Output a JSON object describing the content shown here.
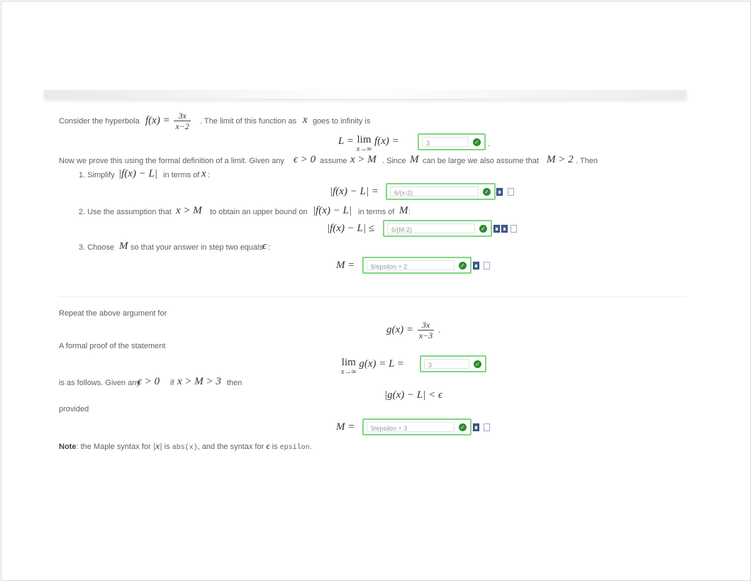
{
  "intro": {
    "consider": "Consider the hyperbola",
    "f_lhs": "f(x) =",
    "f_num": "3x",
    "f_den": "x−2",
    "limit_text": ". The limit of this function as",
    "x": "x",
    "goes_text": "goes to infinity is",
    "L_eq": "L =",
    "lim": "lim",
    "lim_sub": "x→∞",
    "fx_eq": "f(x) =",
    "answer_L": "3"
  },
  "proof_line": {
    "text1": "Now we prove this using the formal definition of a limit. Given any",
    "eps_gt0": "ϵ > 0",
    "assume": "assume",
    "x_gt_M": "x > M",
    "since": ". Since",
    "M": "M",
    "large": "can be large we also assume that",
    "M_gt2": "M > 2",
    "then": ". Then"
  },
  "steps": [
    {
      "label": "1. Simplify",
      "math": "|f(x) − L|",
      "rest": "in terms of",
      "var": "x",
      "tail": ":",
      "lhs": "|f(x) − L| =",
      "answer": "6/(x-2)"
    },
    {
      "label": "2. Use the assumption that",
      "math": "x > M",
      "rest": "to obtain an upper bound on",
      "math2": "|f(x) − L|",
      "rest2": "in terms of",
      "var": "M",
      "tail": ":",
      "lhs": "|f(x) − L| ≤",
      "answer": "6/(M-2)"
    },
    {
      "label": "3. Choose",
      "math": "M",
      "rest": "so that your answer in step two equals",
      "var": "ϵ",
      "tail": ":",
      "lhs": "M =",
      "answer": "6/epsilon + 2"
    }
  ],
  "part2": {
    "repeat": "Repeat the above argument for",
    "g_lhs": "g(x) =",
    "g_num": "3x",
    "g_den": "x−3",
    "formal": "A formal proof of the statement",
    "lim": "lim",
    "lim_sub": "x→∞",
    "gx_eq": "g(x) = L =",
    "answer_L": "3",
    "follows": "is as follows. Given any",
    "eps_gt0": "ϵ > 0",
    "if": "if",
    "chain": "x > M > 3",
    "then": "then",
    "ineq": "|g(x) − L| < ϵ",
    "provided": "provided",
    "M_eq": "M =",
    "answer_M": "9/epsilon + 3"
  },
  "note": {
    "bold": "Note",
    "text1": ": the Maple syntax for",
    "absx": "|x|",
    "is": "is",
    "abs_code": "abs(x)",
    "text2": ", and the syntax for",
    "eps": "ϵ",
    "is2": "is",
    "eps_code": "epsilon",
    "end": "."
  },
  "icons": {
    "check": "check-circle-icon",
    "preview": "preview-doc-icon",
    "help": "help-doc-icon"
  },
  "colors": {
    "answer_border": "#7fd87f",
    "check_green": "#2e8b2e",
    "doc_blue": "#44608f"
  }
}
